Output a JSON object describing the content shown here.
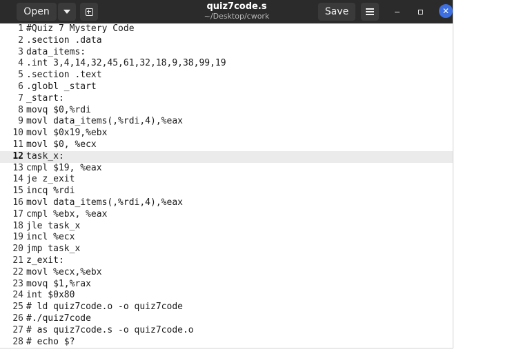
{
  "header": {
    "open_label": "Open",
    "save_label": "Save",
    "title": "quiz7code.s",
    "subtitle": "~/Desktop/cwork",
    "icons": [
      "chevron-down-icon",
      "new-tab-icon",
      "menu-icon",
      "minimize-icon",
      "maximize-icon",
      "close-icon"
    ],
    "close_button_color": "#3d6fe0"
  },
  "editor": {
    "current_line": 12,
    "lines": [
      {
        "n": "1",
        "text": "#Quiz 7 Mystery Code"
      },
      {
        "n": "2",
        "text": ".section .data"
      },
      {
        "n": "3",
        "text": "data_items:"
      },
      {
        "n": "4",
        "text": ".int 3,4,14,32,45,61,32,18,9,38,99,19"
      },
      {
        "n": "5",
        "text": ".section .text"
      },
      {
        "n": "6",
        "text": ".globl _start"
      },
      {
        "n": "7",
        "text": "_start:"
      },
      {
        "n": "8",
        "text": "movq $0,%rdi"
      },
      {
        "n": "9",
        "text": "movl data_items(,%rdi,4),%eax"
      },
      {
        "n": "10",
        "text": "movl $0x19,%ebx"
      },
      {
        "n": "11",
        "text": "movl $0, %ecx"
      },
      {
        "n": "12",
        "text": "task_x:"
      },
      {
        "n": "13",
        "text": "cmpl $19, %eax"
      },
      {
        "n": "14",
        "text": "je z_exit"
      },
      {
        "n": "15",
        "text": "incq %rdi"
      },
      {
        "n": "16",
        "text": "movl data_items(,%rdi,4),%eax"
      },
      {
        "n": "17",
        "text": "cmpl %ebx, %eax"
      },
      {
        "n": "18",
        "text": "jle task_x"
      },
      {
        "n": "19",
        "text": "incl %ecx"
      },
      {
        "n": "20",
        "text": "jmp task_x"
      },
      {
        "n": "21",
        "text": "z_exit:"
      },
      {
        "n": "22",
        "text": "movl %ecx,%ebx"
      },
      {
        "n": "23",
        "text": "movq $1,%rax"
      },
      {
        "n": "24",
        "text": "int $0x80"
      },
      {
        "n": "25",
        "text": "# ld quiz7code.o -o quiz7code"
      },
      {
        "n": "26",
        "text": "#./quiz7code"
      },
      {
        "n": "27",
        "text": "# as quiz7code.s -o quiz7code.o"
      },
      {
        "n": "28",
        "text": "# echo $?"
      }
    ]
  }
}
